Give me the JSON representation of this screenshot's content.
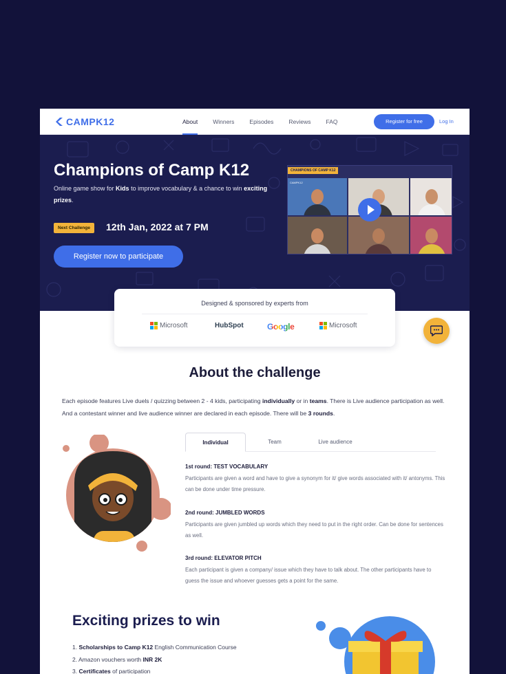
{
  "brand": {
    "name": "CAMPK12",
    "color": "#3f6ee8"
  },
  "nav": {
    "links": [
      "About",
      "Winners",
      "Episodes",
      "Reviews",
      "FAQ"
    ],
    "active": "About",
    "register_label": "Register for free",
    "login_label": "Log In"
  },
  "hero": {
    "title": "Champions of Camp K12",
    "subtitle_pre": "Online game show for ",
    "subtitle_kids": "Kids",
    "subtitle_mid": " to improve vocabulary & a chance to win ",
    "subtitle_prizes": "exciting prizes",
    "subtitle_end": ".",
    "next_badge": "Next Challenge",
    "next_date": "12th Jan, 2022 at 7 PM",
    "cta_label": "Register now to participate",
    "video_caption": "CHAMPIONS OF CAMP K12",
    "video_logo": "CAMPK12"
  },
  "sponsors": {
    "title": "Designed & sponsored by experts from",
    "items": [
      "Microsoft",
      "HubSpot",
      "Google",
      "Microsoft"
    ]
  },
  "about": {
    "title": "About the challenge",
    "p1": "Each episode features Live duels / quizzing between 2 - 4 kids, participating ",
    "b1": "individually",
    "p2": " or in ",
    "b2": "teams",
    "p3": ". There is Live audience participation as well. And a contestant winner and live audience winner are declared in each episode. There will be ",
    "b3": "3 rounds",
    "p4": ".",
    "tabs": [
      "Individual",
      "Team",
      "Live audience"
    ],
    "active_tab": "Individual",
    "rounds": [
      {
        "title": "1st round: TEST VOCABULARY",
        "text": "Participants are given a word and have to give a synonym for it/ give words associated with it/ antonyms. This can be done under time pressure."
      },
      {
        "title": "2nd round: JUMBLED WORDS",
        "text": "Participants are given jumbled up words which they need to put in the right order. Can be done for sentences as well."
      },
      {
        "title": "3rd round: ELEVATOR PITCH",
        "text": "Each participant is given a company/ issue which they have to talk about. The other participants have to guess the issue and whoever guesses gets a point for the same."
      }
    ]
  },
  "prizes": {
    "title": "Exciting prizes to win",
    "items": [
      {
        "num": "1. ",
        "bold": "Scholarships to Camp K12",
        "rest": " English Communication Course"
      },
      {
        "num": "2. ",
        "pre": "Amazon vouchers worth ",
        "bold": "INR 2K"
      },
      {
        "num": "3. ",
        "bold": "Certificates",
        "rest": " of participation"
      }
    ]
  },
  "colors": {
    "background": "#12123a",
    "hero": "#1b1d4f",
    "accent": "#3f6ee8",
    "badge": "#f2b33a"
  },
  "icons": {
    "chat": "chat-bubble-icon",
    "play": "play-icon"
  }
}
